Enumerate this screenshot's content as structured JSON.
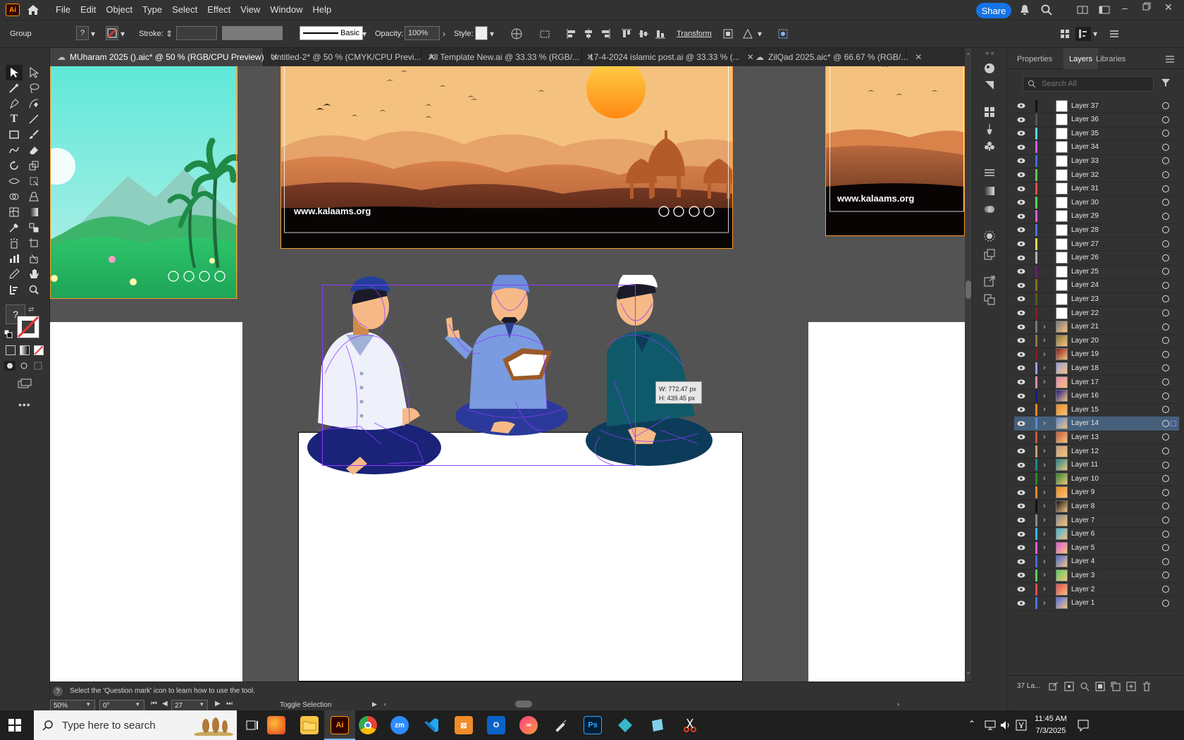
{
  "menubar": {
    "app_logo": "Ai",
    "items": [
      "File",
      "Edit",
      "Object",
      "Type",
      "Select",
      "Effect",
      "View",
      "Window",
      "Help"
    ],
    "share_label": "Share"
  },
  "control_bar": {
    "selection_type": "Group",
    "stroke_label": "Stroke:",
    "brush_label": "Basic",
    "opacity_label": "Opacity:",
    "opacity_value": "100%",
    "style_label": "Style:",
    "transform_label": "Transform"
  },
  "tabs": [
    {
      "label": "MUharam 2025 ().aic* @ 50 % (RGB/CPU Preview)",
      "active": true
    },
    {
      "label": "Untitled-2* @ 50 % (CMYK/CPU Previ...",
      "active": false
    },
    {
      "label": "All Template New.ai @ 33.33 % (RGB/...",
      "active": false
    },
    {
      "label": "17-4-2024 islamic post.ai @ 33.33 % (...",
      "active": false
    },
    {
      "label": "ZilQad 2025.aic* @ 66.67 % (RGB/...",
      "active": false
    }
  ],
  "canvas": {
    "website_text_1": "www.kalaams.org",
    "website_text_2": "www.kalaams.org",
    "tooltip_w": "W: 772.47 px",
    "tooltip_h": "H: 439.45 px"
  },
  "panel": {
    "tabs": [
      "Properties",
      "Layers",
      "Libraries"
    ],
    "active_tab": "Layers",
    "search_placeholder": "Search All",
    "layers": [
      {
        "name": "Layer 37",
        "color": "#111111",
        "expand": false
      },
      {
        "name": "Layer 36",
        "color": "#555555",
        "expand": false
      },
      {
        "name": "Layer 35",
        "color": "#55d8f5",
        "expand": false
      },
      {
        "name": "Layer 34",
        "color": "#d05cf0",
        "expand": false
      },
      {
        "name": "Layer 33",
        "color": "#3f6be0",
        "expand": false
      },
      {
        "name": "Layer 32",
        "color": "#5ec84a",
        "expand": false
      },
      {
        "name": "Layer 31",
        "color": "#e24a4a",
        "expand": false
      },
      {
        "name": "Layer 30",
        "color": "#5ad15a",
        "expand": false
      },
      {
        "name": "Layer 29",
        "color": "#e05cd5",
        "expand": false
      },
      {
        "name": "Layer 28",
        "color": "#4f6fe6",
        "expand": false
      },
      {
        "name": "Layer 27",
        "color": "#e2d84a",
        "expand": false
      },
      {
        "name": "Layer 26",
        "color": "#b2b2b2",
        "expand": false
      },
      {
        "name": "Layer 25",
        "color": "#6a1b7a",
        "expand": false
      },
      {
        "name": "Layer 24",
        "color": "#8a6d1a",
        "expand": false
      },
      {
        "name": "Layer 23",
        "color": "#5a5a1a",
        "expand": false
      },
      {
        "name": "Layer 22",
        "color": "#8a1a2a",
        "expand": false
      },
      {
        "name": "Layer 21",
        "color": "#7a7a7a",
        "expand": true
      },
      {
        "name": "Layer 20",
        "color": "#8a7a3a",
        "expand": true
      },
      {
        "name": "Layer 19",
        "color": "#8a1a1a",
        "expand": true
      },
      {
        "name": "Layer 18",
        "color": "#9aa0e0",
        "expand": true
      },
      {
        "name": "Layer 17",
        "color": "#e88ab0",
        "expand": true
      },
      {
        "name": "Layer 16",
        "color": "#1a1a8a",
        "expand": true
      },
      {
        "name": "Layer 15",
        "color": "#f08a1a",
        "expand": true
      },
      {
        "name": "Layer 14",
        "color": "#5a8ae0",
        "expand": true,
        "selected": true
      },
      {
        "name": "Layer 13",
        "color": "#c85a3a",
        "expand": true
      },
      {
        "name": "Layer 12",
        "color": "#c8a07a",
        "expand": true
      },
      {
        "name": "Layer 11",
        "color": "#1a8a8a",
        "expand": true
      },
      {
        "name": "Layer 10",
        "color": "#2a8a2a",
        "expand": true
      },
      {
        "name": "Layer 9",
        "color": "#f08a1a",
        "expand": true
      },
      {
        "name": "Layer 8",
        "color": "#111111",
        "expand": true
      },
      {
        "name": "Layer 7",
        "color": "#8a8a8a",
        "expand": true
      },
      {
        "name": "Layer 6",
        "color": "#3ab8e0",
        "expand": true
      },
      {
        "name": "Layer 5",
        "color": "#e05cd5",
        "expand": true
      },
      {
        "name": "Layer 4",
        "color": "#4a6ae0",
        "expand": true
      },
      {
        "name": "Layer 3",
        "color": "#5ad15a",
        "expand": true
      },
      {
        "name": "Layer 2",
        "color": "#e24a4a",
        "expand": true
      },
      {
        "name": "Layer 1",
        "color": "#4f6fe6",
        "expand": true
      }
    ],
    "layer_count": "37 La..."
  },
  "status": {
    "hint": "Select the 'Question mark' icon to learn how to use the tool.",
    "zoom": "50%",
    "rotation": "0°",
    "artboard": "27",
    "mode": "Toggle Selection"
  },
  "taskbar": {
    "search_placeholder": "Type here to search",
    "time": "11:45 AM",
    "date": "7/3/2025"
  }
}
